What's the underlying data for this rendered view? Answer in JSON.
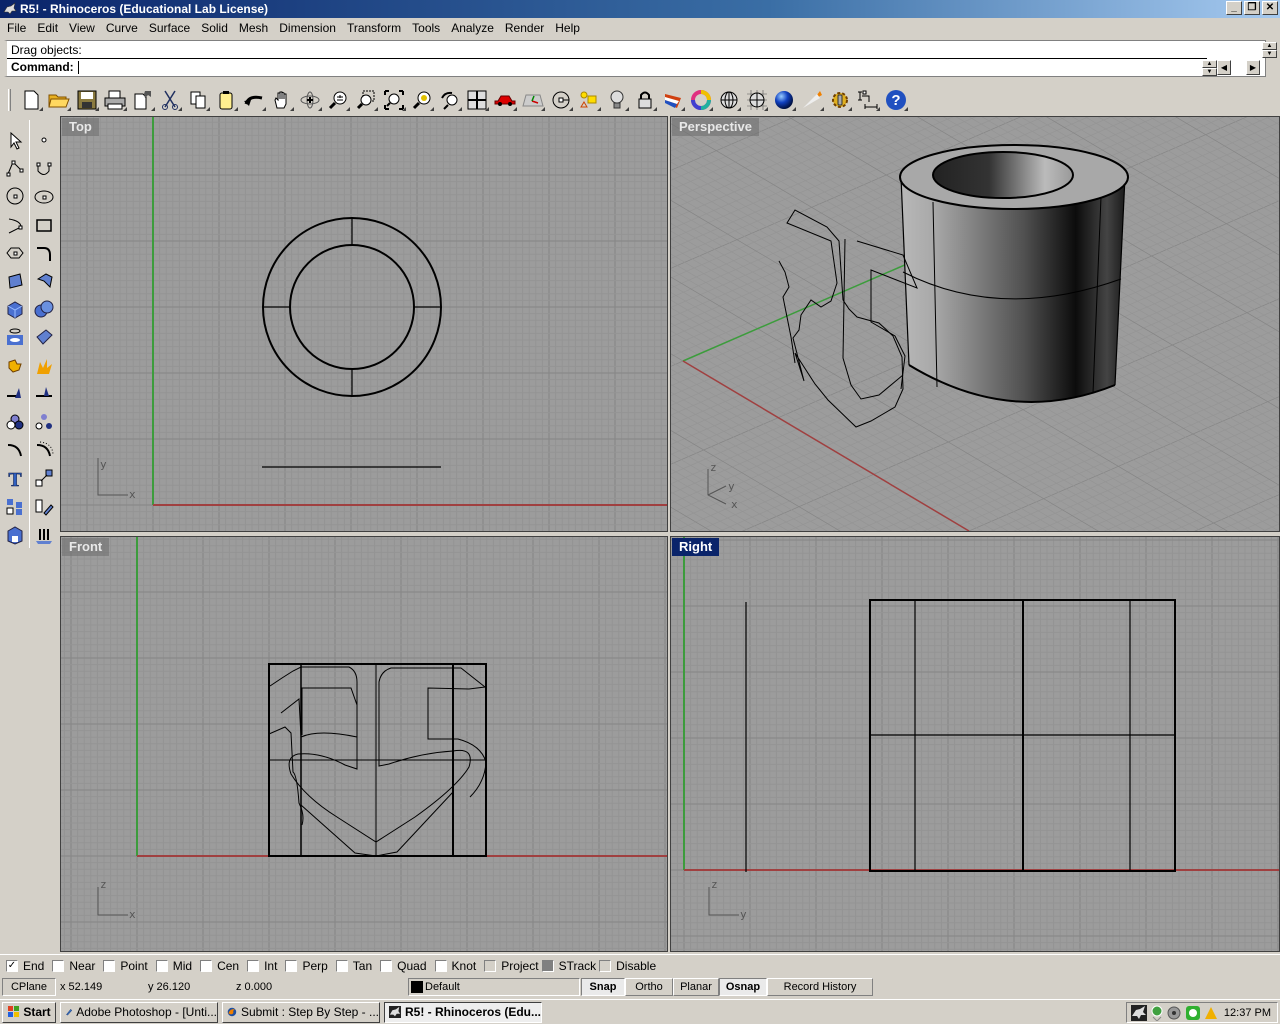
{
  "window": {
    "title": "R5! - Rhinoceros (Educational Lab License)",
    "controls": [
      "minimize",
      "restore",
      "close"
    ]
  },
  "menu": [
    "File",
    "Edit",
    "View",
    "Curve",
    "Surface",
    "Solid",
    "Mesh",
    "Dimension",
    "Transform",
    "Tools",
    "Analyze",
    "Render",
    "Help"
  ],
  "command": {
    "history": "Drag objects:",
    "prompt": "Command:",
    "value": ""
  },
  "toolbar": {
    "icons": [
      "new-document-icon",
      "open-folder-icon",
      "save-icon",
      "print-icon",
      "import-icon",
      "cut-icon",
      "copy-icon",
      "paste-icon",
      "undo-icon",
      "pan-hand-icon",
      "rotate-view-icon",
      "zoom-dynamic-icon",
      "zoom-window-icon",
      "zoom-extents-icon",
      "zoom-selected-icon",
      "undo-view-icon",
      "four-viewports-icon",
      "car-icon",
      "cplane-icon",
      "osnap-point-icon",
      "properties-icon",
      "light-bulb-icon",
      "lock-icon",
      "layer-icon",
      "color-wheel-icon",
      "wireframe-sphere-icon",
      "grid-sphere-icon",
      "shaded-sphere-icon",
      "spotlight-icon",
      "options-gear-icon",
      "dimension-icon",
      "help-icon"
    ]
  },
  "sidebar": {
    "icons": [
      "select-arrow-icon",
      "point-icon",
      "polyline-icon",
      "curve-icon",
      "circle-icon",
      "ellipse-icon",
      "arc-icon",
      "rectangle-icon",
      "polygon-icon",
      "fillet-curve-icon",
      "surface-points-icon",
      "surface-extrude-icon",
      "box-icon",
      "boolean-union-icon",
      "cylinder-icon",
      "network-surface-icon",
      "join-icon",
      "explode-icon",
      "trim-icon",
      "split-icon",
      "group-icon",
      "ungroup-icon",
      "offset-curve-icon",
      "blend-curve-icon",
      "text-icon",
      "scale-icon",
      "array-icon",
      "orient-icon",
      "solid-edit-icon",
      "extrude-arrows-icon"
    ]
  },
  "viewports": {
    "top": {
      "label": "Top",
      "axis_labels": [
        "y",
        "x"
      ]
    },
    "perspective": {
      "label": "Perspective",
      "axis_labels": [
        "z",
        "y",
        "x"
      ]
    },
    "front": {
      "label": "Front",
      "axis_labels": [
        "z",
        "x"
      ]
    },
    "right": {
      "label": "Right",
      "axis_labels": [
        "z",
        "y"
      ],
      "active": true
    }
  },
  "osnaps": [
    {
      "label": "End",
      "checked": true
    },
    {
      "label": "Near",
      "checked": false
    },
    {
      "label": "Point",
      "checked": false
    },
    {
      "label": "Mid",
      "checked": false
    },
    {
      "label": "Cen",
      "checked": false
    },
    {
      "label": "Int",
      "checked": false
    },
    {
      "label": "Perp",
      "checked": false
    },
    {
      "label": "Tan",
      "checked": false
    },
    {
      "label": "Quad",
      "checked": false
    },
    {
      "label": "Knot",
      "checked": false
    },
    {
      "label": "Project",
      "checked": false
    },
    {
      "label": "STrack",
      "checked": false
    },
    {
      "label": "Disable",
      "checked": false
    }
  ],
  "status": {
    "cplane": "CPlane",
    "x": "x 52.149",
    "y": "y 26.120",
    "z": "z 0.000",
    "layer": "Default",
    "layer_color": "#000000",
    "snap": "Snap",
    "ortho": "Ortho",
    "planar": "Planar",
    "osnap": "Osnap",
    "record_history": "Record History"
  },
  "taskbar": {
    "start": "Start",
    "tasks": [
      {
        "label": "Adobe Photoshop - [Unti...",
        "active": false
      },
      {
        "label": "Submit : Step By Step - ...",
        "active": false
      },
      {
        "label": "R5! - Rhinoceros (Edu...",
        "active": true
      }
    ],
    "tray_icons": [
      "rhino-tray-icon",
      "network-tray-icon",
      "volume-tray-icon",
      "messenger-tray-icon",
      "update-tray-icon"
    ],
    "clock": "12:37 PM"
  },
  "colors": {
    "viewport_bg": "#9c9c9c",
    "x_axis": "#a04040",
    "y_axis": "#3c9c3c",
    "title_active": "#0a246a"
  }
}
